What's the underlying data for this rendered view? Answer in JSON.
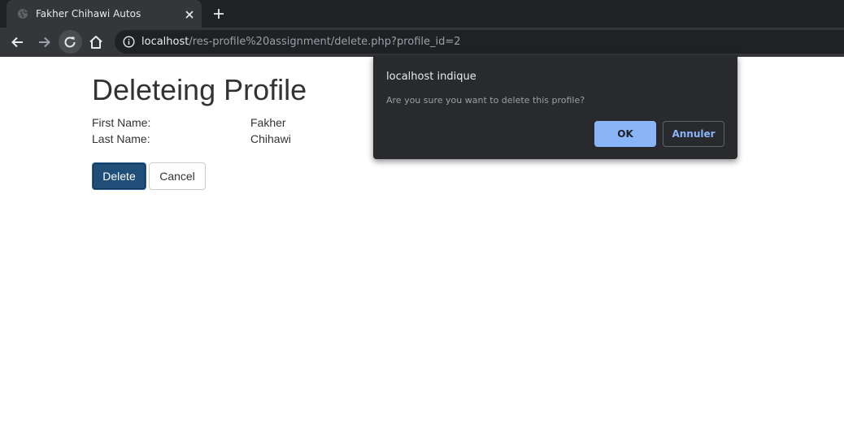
{
  "browser": {
    "tab": {
      "title": "Fakher Chihawi Autos",
      "favicon": "globe-icon"
    },
    "url_host": "localhost",
    "url_path": "/res-profile%20assignment/delete.php?profile_id=2",
    "icons": {
      "close": "close-icon",
      "new_tab": "plus-icon",
      "back": "arrow-left-icon",
      "forward": "arrow-right-icon",
      "reload": "reload-icon",
      "home": "home-icon",
      "site_info": "info-icon"
    }
  },
  "page": {
    "title": "Deleteing Profile",
    "fields": [
      {
        "label": "First Name:",
        "value": "Fakher"
      },
      {
        "label": "Last Name:",
        "value": "Chihawi"
      }
    ],
    "delete_label": "Delete",
    "cancel_label": "Cancel"
  },
  "dialog": {
    "title": "localhost indique",
    "message": "Are you sure you want to delete this profile?",
    "ok_label": "OK",
    "cancel_label": "Annuler"
  },
  "colors": {
    "delete_button": "#1f4e79",
    "dialog_ok": "#8ab4f8",
    "chrome_dark": "#202124"
  }
}
